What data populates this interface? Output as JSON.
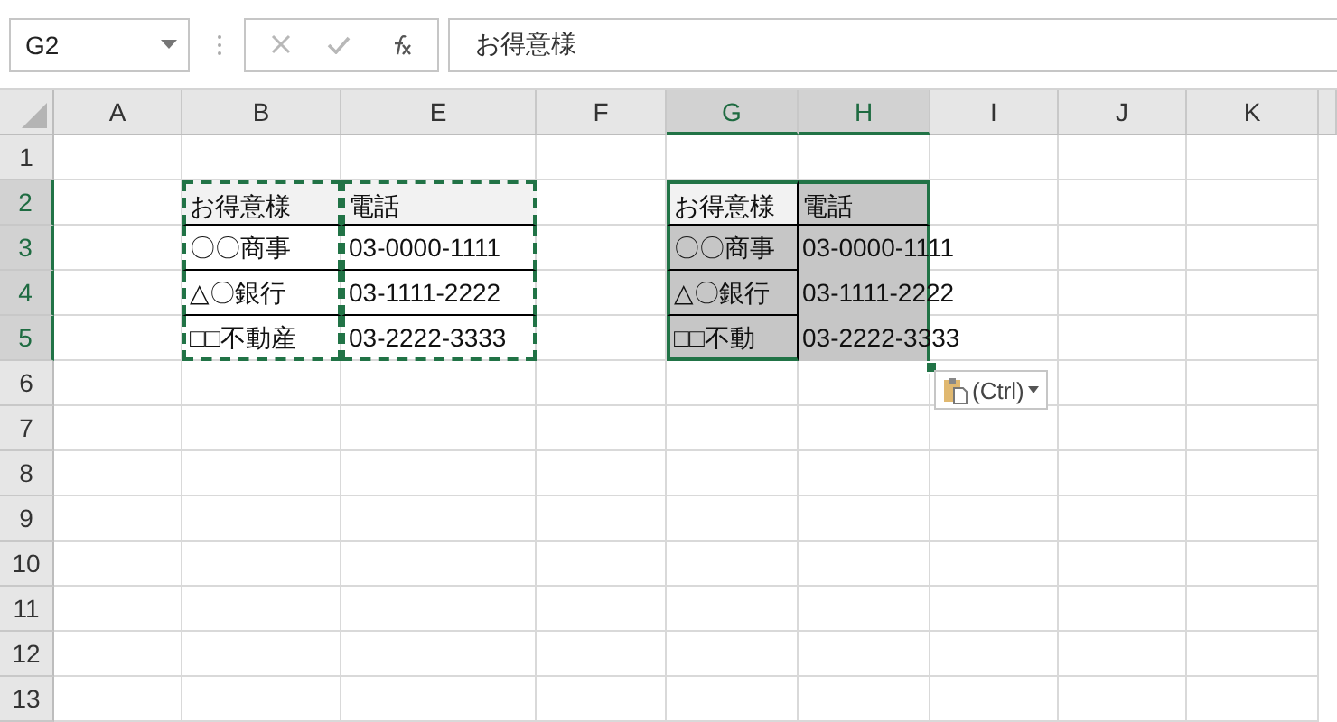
{
  "name_box": {
    "value": "G2"
  },
  "formula_bar": {
    "value": "お得意様"
  },
  "columns": [
    {
      "label": "A",
      "selected": false
    },
    {
      "label": "B",
      "selected": false
    },
    {
      "label": "E",
      "selected": false
    },
    {
      "label": "F",
      "selected": false
    },
    {
      "label": "G",
      "selected": true
    },
    {
      "label": "H",
      "selected": true
    },
    {
      "label": "I",
      "selected": false
    },
    {
      "label": "J",
      "selected": false
    },
    {
      "label": "K",
      "selected": false
    }
  ],
  "rows": [
    {
      "label": "1",
      "selected": false,
      "cells": [
        {},
        {},
        {},
        {},
        {},
        {},
        {},
        {},
        {}
      ]
    },
    {
      "label": "2",
      "selected": true,
      "cells": [
        {},
        {
          "text": "お得意様",
          "header": true,
          "boxed": true,
          "copied": true
        },
        {
          "text": "電話",
          "header": true,
          "boxed": true,
          "copied": true
        },
        {},
        {
          "text": "お得意様",
          "header": true,
          "boxed": true,
          "selected": true,
          "active": true
        },
        {
          "text": "電話",
          "header": true,
          "boxed": true,
          "selected": true,
          "active": false
        },
        {},
        {},
        {}
      ]
    },
    {
      "label": "3",
      "selected": true,
      "cells": [
        {},
        {
          "text": "〇〇商事",
          "boxed": true,
          "copied": true
        },
        {
          "text": "03-0000-1111",
          "boxed": true,
          "copied": true
        },
        {},
        {
          "text": "〇〇商事",
          "boxed": true,
          "selected": true,
          "active": false
        },
        {
          "text": "03-0000-1111",
          "boxed": true,
          "selected": true,
          "active": false
        },
        {},
        {},
        {}
      ]
    },
    {
      "label": "4",
      "selected": true,
      "cells": [
        {},
        {
          "text": "△〇銀行",
          "boxed": true,
          "copied": true
        },
        {
          "text": "03-1111-2222",
          "boxed": true,
          "copied": true
        },
        {},
        {
          "text": "△〇銀行",
          "boxed": true,
          "selected": true,
          "active": false
        },
        {
          "text": "03-1111-2222",
          "boxed": true,
          "selected": true,
          "active": false
        },
        {},
        {},
        {}
      ]
    },
    {
      "label": "5",
      "selected": true,
      "cells": [
        {},
        {
          "text": "□□不動産",
          "boxed": true,
          "copied": true
        },
        {
          "text": "03-2222-3333",
          "boxed": true,
          "copied": true
        },
        {},
        {
          "text": "□□不動",
          "boxed": true,
          "selected": true,
          "active": false
        },
        {
          "text": "03-2222-3333",
          "boxed": true,
          "selected": true,
          "active": false
        },
        {},
        {},
        {}
      ]
    },
    {
      "label": "6",
      "selected": false,
      "cells": [
        {},
        {},
        {},
        {},
        {},
        {},
        {},
        {},
        {}
      ]
    },
    {
      "label": "7",
      "selected": false,
      "cells": [
        {},
        {},
        {},
        {},
        {},
        {},
        {},
        {},
        {}
      ]
    },
    {
      "label": "8",
      "selected": false,
      "cells": [
        {},
        {},
        {},
        {},
        {},
        {},
        {},
        {},
        {}
      ]
    },
    {
      "label": "9",
      "selected": false,
      "cells": [
        {},
        {},
        {},
        {},
        {},
        {},
        {},
        {},
        {}
      ]
    },
    {
      "label": "10",
      "selected": false,
      "cells": [
        {},
        {},
        {},
        {},
        {},
        {},
        {},
        {},
        {}
      ]
    },
    {
      "label": "11",
      "selected": false,
      "cells": [
        {},
        {},
        {},
        {},
        {},
        {},
        {},
        {},
        {}
      ]
    },
    {
      "label": "12",
      "selected": false,
      "cells": [
        {},
        {},
        {},
        {},
        {},
        {},
        {},
        {},
        {}
      ]
    },
    {
      "label": "13",
      "selected": false,
      "cells": [
        {},
        {},
        {},
        {},
        {},
        {},
        {},
        {},
        {}
      ]
    }
  ],
  "paste_options": {
    "label": "(Ctrl)"
  }
}
